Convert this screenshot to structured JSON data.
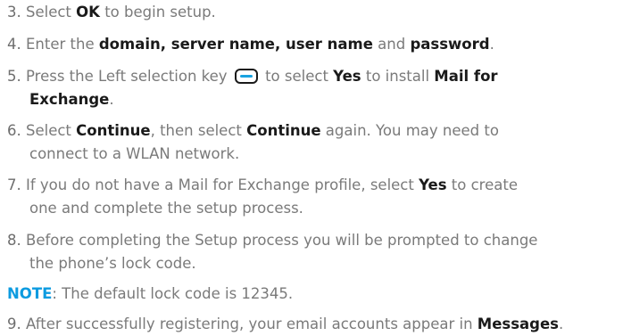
{
  "steps": {
    "s3": {
      "num": "3.",
      "t1": "Select ",
      "b1": "OK",
      "t2": " to begin setup."
    },
    "s4": {
      "num": "4.",
      "t1": "Enter the ",
      "b1": "domain, server name, user name",
      "t2": " and ",
      "b2": "password",
      "t3": "."
    },
    "s5": {
      "num": "5.",
      "t1": "Press the Left selection key ",
      "t2": " to select ",
      "b1": "Yes",
      "t3": " to install ",
      "b2": "Mail for",
      "b3": "Exchange",
      "t4": "."
    },
    "s6": {
      "num": "6.",
      "t1": "Select ",
      "b1": "Continue",
      "t2": ", then select ",
      "b2": "Continue",
      "t3": " again. You may need to",
      "l2": "connect to a WLAN network."
    },
    "s7": {
      "num": "7.",
      "t1": "If you do not have a Mail for Exchange profile, select ",
      "b1": "Yes",
      "t2": " to create",
      "l2": "one and complete the setup process."
    },
    "s8": {
      "num": "8.",
      "l1": "Before completing the Setup process you will be prompted to change",
      "l2": "the phone’s lock code."
    },
    "note": {
      "label": "NOTE",
      "text": ": The default lock code is 12345."
    },
    "s9": {
      "num": "9.",
      "t1": "After successfully registering, your email accounts appear in ",
      "b1": "Messages",
      "t2": "."
    }
  },
  "icons": {
    "left_selection_key": "left-selection-key-icon"
  },
  "colors": {
    "text": "#7a7a7a",
    "bold": "#1a1a1a",
    "note": "#0c9be0",
    "key_accent": "#18a2e0"
  }
}
